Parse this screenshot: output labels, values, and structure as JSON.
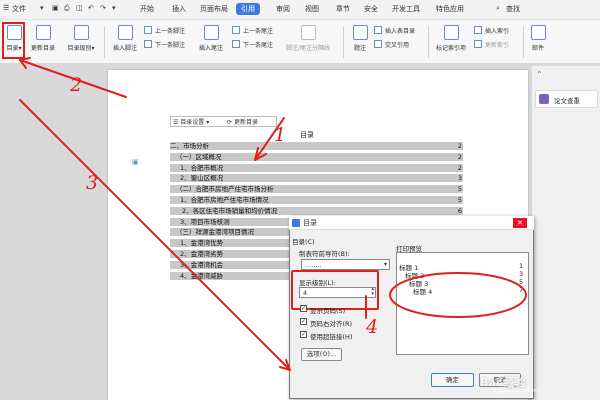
{
  "menu": {
    "file": "文件",
    "tabs": [
      "开始",
      "插入",
      "页面布局",
      "引用",
      "审阅",
      "视图",
      "章节",
      "安全",
      "开发工具",
      "特色应用"
    ],
    "active_tab": "引用",
    "search_label": "查找"
  },
  "toolbar": {
    "toc": "目录",
    "update_toc": "更新目录",
    "toc_level": "目录级别",
    "insert_footnote": "插入脚注",
    "prev_footnote": "上一条脚注",
    "next_footnote": "下一条脚注",
    "insert_endnote": "插入尾注",
    "prev_endnote": "上一条尾注",
    "next_endnote": "下一条尾注",
    "footnote_separator": "脚注/尾注分隔线",
    "caption": "题注",
    "insert_figure_index": "插入表目录",
    "cross_reference": "交叉引用",
    "mark_index_entry": "标记索引项",
    "insert_index": "插入索引",
    "update_index": "更新索引",
    "mail": "邮件"
  },
  "toc_tools": {
    "settings": "目录设置",
    "update": "更新目录"
  },
  "document": {
    "toc_title": "目录",
    "toc_entries": [
      {
        "text": "二、市场分析",
        "page": "2"
      },
      {
        "text": "（一）区域概况",
        "page": "2"
      },
      {
        "text": "1、合肥市概况",
        "page": "2"
      },
      {
        "text": "2、蜀山区概况",
        "page": "3"
      },
      {
        "text": "（二）合肥市房地产住宅市场分析",
        "page": "5"
      },
      {
        "text": "1、合肥市房地产住宅市场情况",
        "page": "5"
      },
      {
        "text": "2、各区住宅市场销量和均价情况",
        "page": "6"
      },
      {
        "text": "3、项目市场核测",
        "page": ""
      },
      {
        "text": "（三）祥源金港湾项目情况",
        "page": ""
      },
      {
        "text": "1、金港湾优势",
        "page": ""
      },
      {
        "text": "2、金港湾劣势",
        "page": ""
      },
      {
        "text": "3、金港湾机会",
        "page": ""
      },
      {
        "text": "4、金港湾威胁",
        "page": ""
      }
    ]
  },
  "side_panel": {
    "paper_check": "论文查重"
  },
  "dialog": {
    "title": "目录",
    "section_label": "目录(C)",
    "leader_label": "制表符前导符(B):",
    "leader_value": "........",
    "preview_label": "打印预览",
    "levels_label": "显示级别(L):",
    "levels_value": "4",
    "show_page_numbers": "显示页码(S)",
    "right_align_page_numbers": "页码右对齐(R)",
    "use_hyperlinks": "使用超链接(H)",
    "options_button": "选项(O)...",
    "ok": "确定",
    "cancel": "取消",
    "preview": [
      {
        "text": "标题 1",
        "page": "1"
      },
      {
        "text": "标题 2",
        "page": "3"
      },
      {
        "text": "标题 3",
        "page": "5"
      },
      {
        "text": "标题 4",
        "page": "7"
      }
    ]
  },
  "annotations": [
    "1",
    "2",
    "3",
    "4"
  ],
  "watermark": {
    "main": "Bai 经验",
    "sub": "jingyan.baidu.com"
  }
}
